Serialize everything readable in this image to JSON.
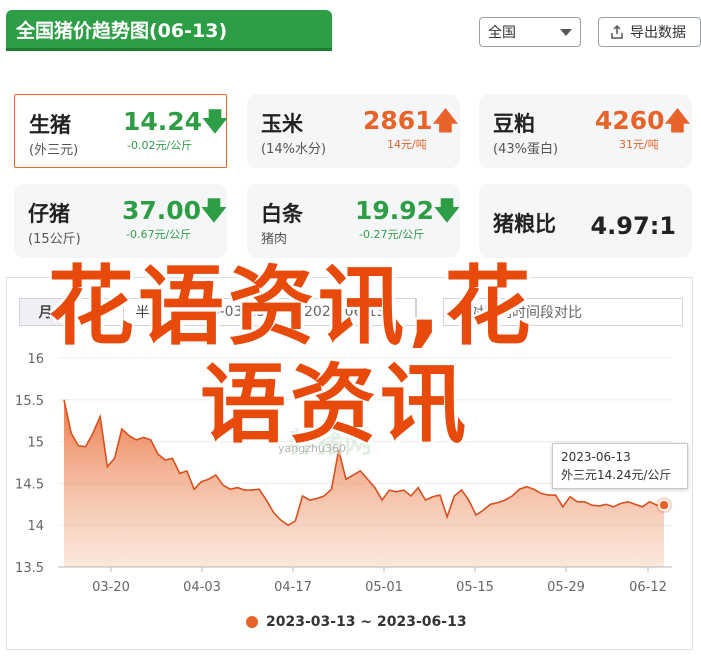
{
  "header": {
    "title": "全国猪价趋势图(06-13)",
    "region_select": "全国",
    "export_label": "导出数据"
  },
  "cards": [
    {
      "name": "生猪",
      "sub": "(外三元)",
      "price": "14.24",
      "direction": "down",
      "change": "-0.02元/公斤"
    },
    {
      "name": "玉米",
      "sub": "(14%水分)",
      "price": "2861",
      "direction": "up",
      "change": "14元/吨"
    },
    {
      "name": "豆粕",
      "sub": "(43%蛋白)",
      "price": "4260",
      "direction": "up",
      "change": "31元/吨"
    },
    {
      "name": "仔猪",
      "sub": "(15公斤)",
      "price": "37.00",
      "direction": "down",
      "change": "-0.67元/公斤"
    },
    {
      "name": "白条",
      "sub": "猪肉",
      "price": "19.92",
      "direction": "down",
      "change": "-0.27元/公斤"
    },
    {
      "name": "猪粮比",
      "sub": "",
      "price": "4.97:1",
      "direction": "none",
      "change": ""
    }
  ],
  "chart_controls": {
    "tabs": [
      "月",
      "季",
      "半年"
    ],
    "date_start": "2023-03-13",
    "date_end": "2023-06-13",
    "compare_label": "对比",
    "compare_hint": "对比同时间段对比"
  },
  "tooltip": {
    "date": "2023-06-13",
    "text": "外三元14.24元/公斤"
  },
  "legend": {
    "range": "2023-03-13 ~ 2023-06-13"
  },
  "watermark": {
    "text": "养猪网",
    "url": "yangzhu360"
  },
  "overlay": {
    "line1": "花语资讯,花",
    "line2": "语资讯"
  },
  "colors": {
    "brand_green": "#2e9e46",
    "series_orange": "#e8632a",
    "overlay_red": "#e84a0c"
  },
  "chart_data": {
    "type": "area",
    "title": "",
    "xlabel": "",
    "ylabel": "",
    "ylim": [
      13.5,
      16
    ],
    "yticks": [
      "13.5",
      "14",
      "14.5",
      "15",
      "15.5",
      "16"
    ],
    "xticks": [
      "03-20",
      "04-03",
      "04-17",
      "05-01",
      "05-15",
      "05-29",
      "06-12"
    ],
    "series": [
      {
        "name": "外三元",
        "values": [
          15.5,
          15.1,
          14.95,
          14.94,
          15.1,
          15.3,
          14.7,
          14.8,
          15.15,
          15.07,
          15.02,
          15.05,
          15.02,
          14.85,
          14.78,
          14.8,
          14.62,
          14.65,
          14.43,
          14.52,
          14.55,
          14.6,
          14.48,
          14.43,
          14.45,
          14.42,
          14.42,
          14.43,
          14.3,
          14.15,
          14.06,
          14.0,
          14.05,
          14.35,
          14.3,
          14.32,
          14.35,
          14.43,
          14.9,
          14.55,
          14.6,
          14.65,
          14.55,
          14.45,
          14.3,
          14.42,
          14.4,
          14.42,
          14.35,
          14.45,
          14.3,
          14.34,
          14.36,
          14.1,
          14.35,
          14.42,
          14.3,
          14.12,
          14.18,
          14.25,
          14.27,
          14.3,
          14.35,
          14.43,
          14.46,
          14.43,
          14.38,
          14.36,
          14.36,
          14.22,
          14.34,
          14.28,
          14.28,
          14.24,
          14.23,
          14.25,
          14.22,
          14.26,
          14.28,
          14.25,
          14.22,
          14.28,
          14.24,
          14.24
        ]
      }
    ]
  }
}
